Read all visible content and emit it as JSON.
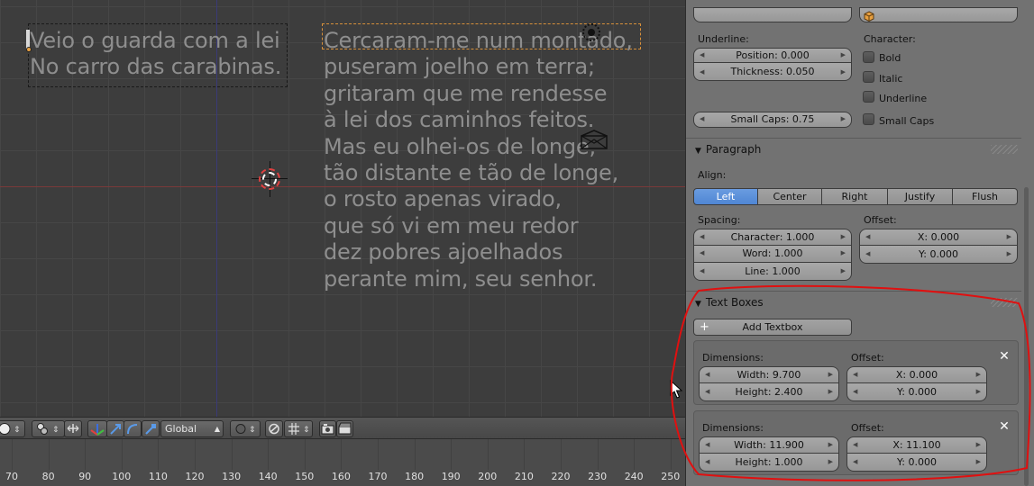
{
  "viewport": {
    "text_obj_a": {
      "lines": [
        "Veio o guarda com a lei",
        "No carro das carabinas."
      ]
    },
    "text_obj_b": {
      "lines": [
        "Cercaram-me num montado,",
        "puseram joelho em terra;",
        "gritaram que me rendesse",
        "à lei dos caminhos feitos.",
        "Mas eu olhei-os de longe,",
        "tão distante e tão de longe,",
        "o rosto apenas virado,",
        "que só vi em meu redor",
        "dez pobres ajoelhados",
        "perante mim, seu senhor."
      ]
    }
  },
  "header": {
    "orientation": "Global",
    "icons": [
      "shading-sphere-icon",
      "pivot-icon",
      "manipulator-toggle-icon",
      "translate-icon",
      "rotate-icon",
      "scale-icon",
      "proportional-edit-icon",
      "snap-toggle-icon",
      "snap-element-icon",
      "render-icon",
      "clapboard-icon"
    ]
  },
  "timeline": {
    "labels": [
      "70",
      "80",
      "90",
      "100",
      "110",
      "120",
      "130",
      "140",
      "150",
      "160",
      "170",
      "180",
      "190",
      "200",
      "210",
      "220",
      "230",
      "240",
      "250"
    ]
  },
  "panel": {
    "underline": {
      "label": "Underline:",
      "position": "Position: 0.000",
      "thickness": "Thickness: 0.050"
    },
    "character": {
      "label": "Character:",
      "bold": "Bold",
      "italic": "Italic",
      "underline": "Underline",
      "small_caps": "Small Caps"
    },
    "small_caps_scale": "Small Caps: 0.75",
    "paragraph": {
      "title": "Paragraph",
      "align_label": "Align:",
      "align_options": [
        "Left",
        "Center",
        "Right",
        "Justify",
        "Flush"
      ],
      "align_selected": "Left",
      "spacing_label": "Spacing:",
      "character": "Character: 1.000",
      "word": "Word: 1.000",
      "line": "Line: 1.000",
      "offset_label": "Offset:",
      "offset_x": "X: 0.000",
      "offset_y": "Y: 0.000"
    },
    "text_boxes": {
      "title": "Text Boxes",
      "add_button": "Add Textbox",
      "boxes": [
        {
          "dimensions_label": "Dimensions:",
          "width": "Width: 9.700",
          "height": "Height: 2.400",
          "offset_label": "Offset:",
          "x": "X: 0.000",
          "y": "Y: 0.000"
        },
        {
          "dimensions_label": "Dimensions:",
          "width": "Width: 11.900",
          "height": "Height: 1.000",
          "offset_label": "Offset:",
          "x": "X: 11.100",
          "y": "Y: 0.000"
        }
      ]
    }
  },
  "colors": {
    "active_accent": "#5a90d8",
    "annotation": "#e01010",
    "viewport_bg": "#3d3d3d",
    "panel_bg": "#727272"
  }
}
